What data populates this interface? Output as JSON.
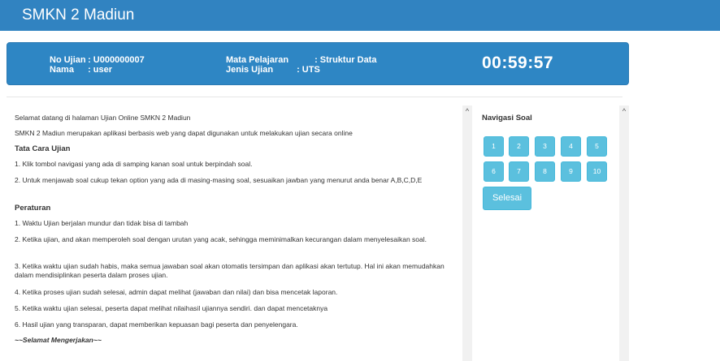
{
  "header": {
    "brand": "SMKN 2 Madiun"
  },
  "exam_info": {
    "no_ujian_label": "No Ujian",
    "no_ujian_value": ": U000000007",
    "nama_label": "Nama",
    "nama_value": ": user",
    "mapel_label": "Mata Pelajaran",
    "mapel_value": ": Struktur Data",
    "jenis_label": "Jenis Ujian",
    "jenis_value": ": UTS",
    "timer": "00:59:57"
  },
  "content": {
    "welcome": "Selamat datang di halaman Ujian Online SMKN 2 Madiun",
    "intro": "SMKN 2 Madiun merupakan aplikasi berbasis web yang dapat digunakan untuk melakukan ujian secara online",
    "tata_cara_title": "Tata Cara Ujian",
    "tata_cara": [
      "1. Klik tombol navigasi yang ada di samping kanan soal untuk berpindah soal.",
      "2. Untuk menjawab soal cukup tekan option yang ada di masing-masing soal, sesuaikan jawban yang menurut anda benar A,B,C,D,E"
    ],
    "peraturan_title": "Peraturan",
    "peraturan": [
      "1. Waktu Ujian berjalan mundur dan tidak bisa di tambah",
      "2. Ketika ujian, and akan memperoleh soal dengan urutan yang acak, sehingga meminimalkan kecurangan dalam menyelesaikan soal.",
      "3. Ketika waktu ujian sudah habis, maka semua jawaban soal akan otomatis tersimpan dan aplikasi akan tertutup. Hal ini akan memudahkan dalam mendisiplinkan peserta dalam proses ujian.",
      "4. Ketika proses ujian sudah selesai, admin dapat melihat (jawaban dan nilai) dan bisa mencetak laporan.",
      "5. Ketika waktu ujian selesai, peserta dapat melihat nilaihasil ujiannya sendiri. dan dapat mencetaknya",
      "6. Hasil ujian yang transparan, dapat memberikan kepuasan bagi peserta dan penyelengara."
    ],
    "closing": "~~Selamat Mengerjakan~~"
  },
  "navigation": {
    "title": "Navigasi Soal",
    "questions": [
      "1",
      "2",
      "3",
      "4",
      "5",
      "6",
      "7",
      "8",
      "9",
      "10"
    ],
    "finish_label": "Selesai"
  },
  "scrollbar": {
    "arrow_up": "^"
  },
  "colors": {
    "primary": "#3183c1",
    "button": "#5bc0de"
  }
}
